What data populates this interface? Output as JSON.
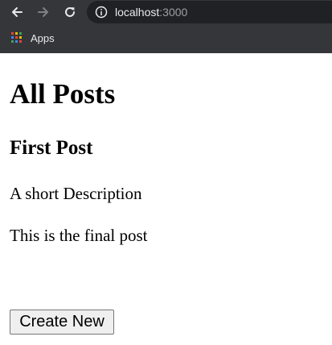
{
  "browser": {
    "address_bar": {
      "host": "localhost",
      "port": ":3000"
    },
    "bookmarks_bar": {
      "apps_label": "Apps"
    },
    "icons": {
      "back": "back-arrow-icon",
      "forward": "forward-arrow-icon",
      "reload": "reload-icon",
      "site_info": "info-icon",
      "apps": "apps-grid-icon"
    },
    "colors": {
      "chrome_bg": "#35363a",
      "omnibox_bg": "#202124",
      "apps_grid": [
        "#ea4335",
        "#fbbc04",
        "#34a853",
        "#4285f4"
      ]
    }
  },
  "page": {
    "title": "All Posts",
    "posts": [
      {
        "title": "First Post",
        "description": "A short Description",
        "body": "This is the final post"
      }
    ],
    "create_button_label": "Create New"
  }
}
